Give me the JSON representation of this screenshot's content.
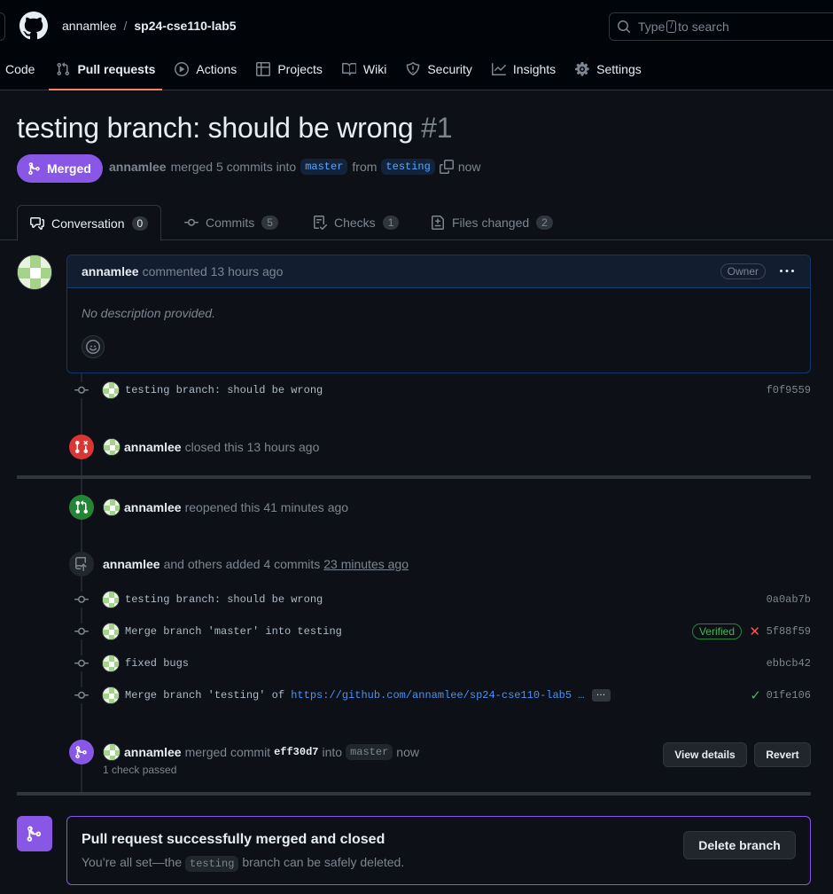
{
  "header": {
    "owner": "annamlee",
    "separator": "/",
    "repo": "sp24-cse110-lab5",
    "search_prefix": "Type",
    "search_key": "/",
    "search_suffix": "to search"
  },
  "nav": [
    {
      "label": "Code",
      "icon": "code-icon"
    },
    {
      "label": "Pull requests",
      "icon": "git-pull-request-icon",
      "active": true
    },
    {
      "label": "Actions",
      "icon": "play-icon"
    },
    {
      "label": "Projects",
      "icon": "table-icon"
    },
    {
      "label": "Wiki",
      "icon": "book-icon"
    },
    {
      "label": "Security",
      "icon": "shield-icon"
    },
    {
      "label": "Insights",
      "icon": "graph-icon"
    },
    {
      "label": "Settings",
      "icon": "gear-icon"
    }
  ],
  "pr": {
    "title": "testing branch: should be wrong",
    "number": "#1",
    "state": "Merged",
    "author": "annamlee",
    "merged_text": "merged 5 commits into",
    "base_branch": "master",
    "from_text": "from",
    "head_branch": "testing",
    "time": "now"
  },
  "tabs": [
    {
      "label": "Conversation",
      "count": "0",
      "icon": "comment-discussion-icon",
      "active": true
    },
    {
      "label": "Commits",
      "count": "5",
      "icon": "git-commit-icon"
    },
    {
      "label": "Checks",
      "count": "1",
      "icon": "checklist-icon"
    },
    {
      "label": "Files changed",
      "count": "2",
      "icon": "file-diff-icon"
    }
  ],
  "comment": {
    "author": "annamlee",
    "action": "commented 13 hours ago",
    "role": "Owner",
    "body": "No description provided."
  },
  "commit_first": {
    "message": "testing branch: should be wrong",
    "sha": "f0f9559"
  },
  "closed_event": {
    "user": "annamlee",
    "text": "closed this 13 hours ago"
  },
  "reopened_event": {
    "user": "annamlee",
    "text": "reopened this 41 minutes ago"
  },
  "added_event": {
    "user": "annamlee",
    "text": "and others added 4 commits",
    "time": "23 minutes ago"
  },
  "commits": [
    {
      "message": "testing branch: should be wrong",
      "sha": "0a0ab7b"
    },
    {
      "message": "Merge branch 'master' into testing",
      "sha": "5f88f59",
      "badge": "Verified",
      "status": "failure"
    },
    {
      "message": "fixed bugs",
      "sha": "ebbcb42"
    },
    {
      "message_prefix": "Merge branch 'testing' of",
      "link": "https://github.com/annamlee/sp24-cse110-lab5 …",
      "ellipsis": "…",
      "sha": "01fe106",
      "status": "success"
    }
  ],
  "merged_event": {
    "user": "annamlee",
    "text": "merged commit",
    "commit": "eff30d7",
    "into": "into",
    "branch": "master",
    "time": "now",
    "checks": "1 check passed",
    "view_details": "View details",
    "revert": "Revert"
  },
  "merge_box": {
    "title": "Pull request successfully merged and closed",
    "sub_prefix": "You’re all set—the",
    "branch": "testing",
    "sub_suffix": "branch can be safely deleted.",
    "delete_button": "Delete branch"
  },
  "colors": {
    "merged": "#8957e5",
    "closed": "#da3633",
    "open": "#238636",
    "accent_underline": "#f78166",
    "link": "#4493f8"
  }
}
